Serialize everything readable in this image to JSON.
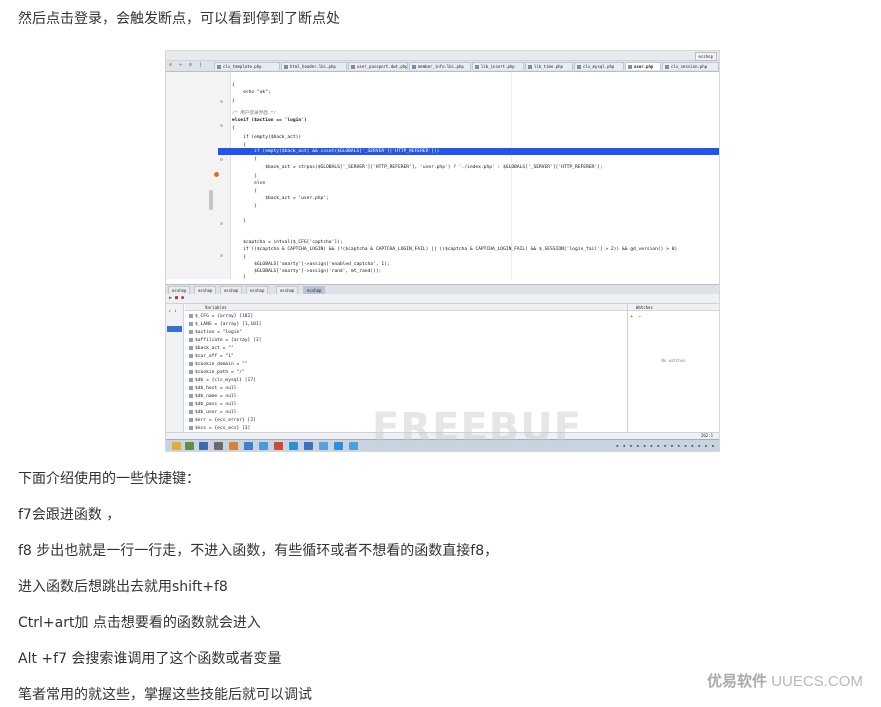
{
  "intro": "然后点击登录，会触发断点，可以看到停到了断点处",
  "screenshot": {
    "top_button": "ecshop",
    "tabs": [
      {
        "label": "cls_template.php",
        "active": false
      },
      {
        "label": "html_header.lbi.php",
        "active": false
      },
      {
        "label": "user_passport.dwt.php",
        "active": false
      },
      {
        "label": "member_info.lbi.php",
        "active": false
      },
      {
        "label": "lib_insert.php",
        "active": false
      },
      {
        "label": "lib_time.php",
        "active": false
      },
      {
        "label": "cls_mysql.php",
        "active": false
      },
      {
        "label": "user.php",
        "active": true
      },
      {
        "label": "cls_session.php",
        "active": false
      }
    ],
    "code_lines": [
      "{",
      "    echo \"ok\";",
      "}",
      "/* 用户登录界面 */",
      "elseif ($action == 'login')",
      "{",
      "    if (empty($back_act))",
      "    {",
      "        if (empty($back_act) && isset($GLOBALS['_SERVER']['HTTP_REFERER']))",
      "        {",
      "            $back_act = strpos($GLOBALS['_SERVER']['HTTP_REFERER'], 'user.php') ? './index.php' : $GLOBALS['_SERVER']['HTTP_REFERER'];",
      "        }",
      "        else",
      "        {",
      "            $back_act = 'user.php';",
      "        }",
      "",
      "    }",
      "",
      "",
      "",
      "    $captcha = intval($_CFG['captcha']);",
      "    if (($captcha & CAPTCHA_LOGIN) && (!($captcha & CAPTCHA_LOGIN_FAIL) || (($captcha & CAPTCHA_LOGIN_FAIL) && $_SESSION['login_fail'] > 2)) && gd_version() > 0)",
      "    {",
      "        $GLOBALS['smarty']->assign('enabled_captcha', 1);",
      "        $GLOBALS['smarty']->assign('rand', mt_rand());",
      "    }"
    ],
    "debug_tabs": [
      {
        "label": "ecshop",
        "active": false
      },
      {
        "label": "ecshop",
        "active": false
      },
      {
        "label": "ecshop",
        "active": false
      },
      {
        "label": "ecshop",
        "active": false
      },
      {
        "label": "ecshop",
        "active": false
      },
      {
        "label": "ecshop",
        "active": true
      }
    ],
    "variables_title": "Variables",
    "variables": [
      "$_CFG = {array} [182]",
      "$_LANG = {array} [1,181]",
      "$action = \"login\"",
      "$affiliate = {array} [3]",
      "$back_act = \"\"",
      "$car_off = \"1\"",
      "$cookie_domain = \"\"",
      "$cookie_path = \"/\"",
      "$db = {cls_mysql} [17]",
      "$db_host = null",
      "$db_name = null",
      "$db_pass = null",
      "$db_user = null",
      "$err = {ecs_error} [2]",
      "$ecs = {ecs_ecs} [3]"
    ],
    "watches_title": "Watches",
    "watches_empty": "No watches",
    "status_pos": "262:1",
    "watermark": "FREEBUF"
  },
  "heading": "下面介绍使用的一些快捷键：",
  "items": [
    "f7会跟进函数 ，",
    "f8 步出也就是一行一行走，不进入函数，有些循环或者不想看的函数直接f8，",
    "进入函数后想跳出去就用shift+f8",
    "Ctrl+art加 点击想要看的函数就会进入",
    "Alt +f7 会搜索谁调用了这个函数或者变量",
    "笔者常用的就这些，掌握这些技能后就可以调试"
  ],
  "brand": {
    "cn": "优易软件",
    "en": "UUECS.COM"
  }
}
